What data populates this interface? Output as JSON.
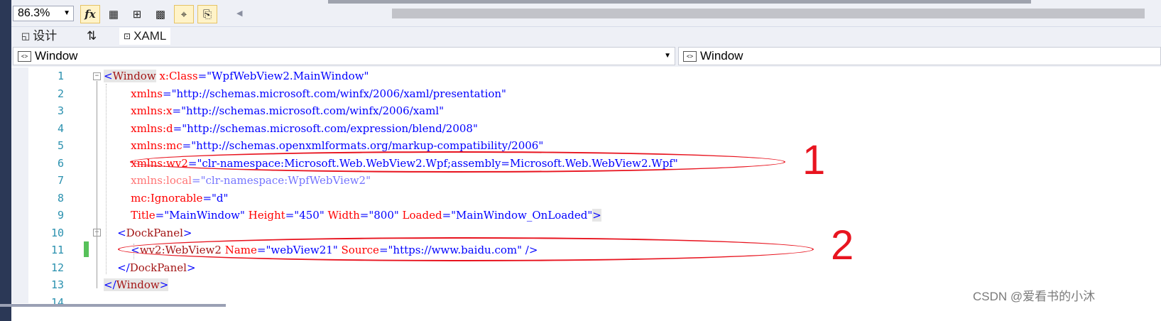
{
  "toolbar": {
    "zoom": "86.3%",
    "buttons": [
      "fx-icon",
      "grid-icon",
      "snap-grid-icon",
      "checker-icon",
      "snap-lines-icon",
      "device-icon"
    ]
  },
  "tabs": {
    "design": "设计",
    "swap": "⇅",
    "xaml": "XAML"
  },
  "nav": {
    "left": "Window",
    "right": "Window"
  },
  "code": {
    "line_numbers": [
      "1",
      "2",
      "3",
      "4",
      "5",
      "6",
      "7",
      "8",
      "9",
      "10",
      "11",
      "12",
      "13",
      "14"
    ],
    "lines": [
      {
        "parts": [
          [
            "p",
            "<"
          ],
          [
            "t",
            "Window"
          ],
          [
            "a",
            " x:Class"
          ],
          [
            "p",
            "="
          ],
          [
            "v",
            "\"WpfWebView2.MainWindow\""
          ]
        ]
      },
      {
        "parts": [
          [
            "a",
            "        xmlns"
          ],
          [
            "p",
            "="
          ],
          [
            "v",
            "\"http://schemas.microsoft.com/winfx/2006/xaml/presentation\""
          ]
        ]
      },
      {
        "parts": [
          [
            "a",
            "        xmlns:x"
          ],
          [
            "p",
            "="
          ],
          [
            "v",
            "\"http://schemas.microsoft.com/winfx/2006/xaml\""
          ]
        ]
      },
      {
        "parts": [
          [
            "a",
            "        xmlns:d"
          ],
          [
            "p",
            "="
          ],
          [
            "v",
            "\"http://schemas.microsoft.com/expression/blend/2008\""
          ]
        ]
      },
      {
        "parts": [
          [
            "a",
            "        xmlns:mc"
          ],
          [
            "p",
            "="
          ],
          [
            "v",
            "\"http://schemas.openxmlformats.org/markup-compatibility/2006\""
          ]
        ]
      },
      {
        "parts": [
          [
            "a",
            "        xmlns:wv2"
          ],
          [
            "p",
            "="
          ],
          [
            "v",
            "\"clr-namespace:Microsoft.Web.WebView2.Wpf;assembly=Microsoft.Web.WebView2.Wpf\""
          ]
        ]
      },
      {
        "dim": true,
        "parts": [
          [
            "a",
            "        xmlns:local"
          ],
          [
            "p",
            "="
          ],
          [
            "v",
            "\"clr-namespace:WpfWebView2\""
          ]
        ]
      },
      {
        "parts": [
          [
            "a",
            "        mc:Ignorable"
          ],
          [
            "p",
            "="
          ],
          [
            "v",
            "\"d\""
          ]
        ]
      },
      {
        "parts": [
          [
            "a",
            "        Title"
          ],
          [
            "p",
            "="
          ],
          [
            "v",
            "\"MainWindow\""
          ],
          [
            "a",
            " Height"
          ],
          [
            "p",
            "="
          ],
          [
            "v",
            "\"450\""
          ],
          [
            "a",
            " Width"
          ],
          [
            "p",
            "="
          ],
          [
            "v",
            "\"800\""
          ],
          [
            "a",
            " Loaded"
          ],
          [
            "p",
            "="
          ],
          [
            "v",
            "\"MainWindow_OnLoaded\""
          ],
          [
            "p",
            ">"
          ]
        ]
      },
      {
        "parts": [
          [
            "p",
            "    <"
          ],
          [
            "t",
            "DockPanel"
          ],
          [
            "p",
            ">"
          ]
        ]
      },
      {
        "parts": [
          [
            "p",
            "        <"
          ],
          [
            "t",
            "wv2:WebView2"
          ],
          [
            "a",
            " Name"
          ],
          [
            "p",
            "="
          ],
          [
            "v",
            "\"webView21\""
          ],
          [
            "a",
            " Source"
          ],
          [
            "p",
            "="
          ],
          [
            "v",
            "\"https://www.baidu.com\""
          ],
          [
            "p",
            " />"
          ]
        ]
      },
      {
        "parts": [
          [
            "p",
            "    </"
          ],
          [
            "t",
            "DockPanel"
          ],
          [
            "p",
            ">"
          ]
        ]
      },
      {
        "parts": [
          [
            "p",
            "</"
          ],
          [
            "t",
            "Window"
          ],
          [
            "p",
            ">"
          ]
        ]
      },
      {
        "parts": []
      }
    ]
  },
  "annotations": {
    "label1": "1",
    "label2": "2",
    "color": "#e8141f"
  },
  "watermark": "CSDN @爱看书的小沐"
}
